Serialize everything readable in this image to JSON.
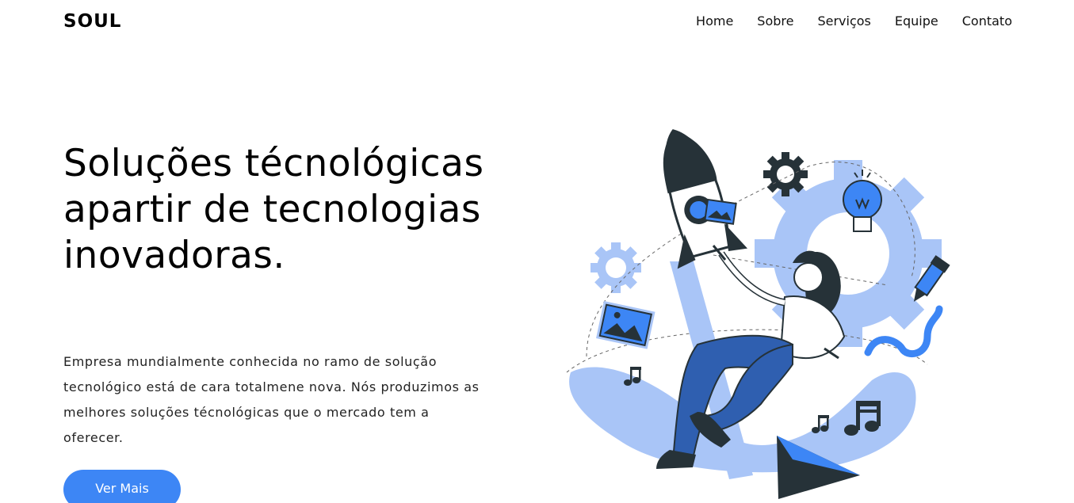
{
  "brand": {
    "name": "SOUL"
  },
  "nav": {
    "items": [
      {
        "label": "Home"
      },
      {
        "label": "Sobre"
      },
      {
        "label": "Serviços"
      },
      {
        "label": "Equipe"
      },
      {
        "label": "Contato"
      }
    ]
  },
  "hero": {
    "title": "Soluções técnológicas apartir de tecnologias inovadoras.",
    "description": "Empresa mundialmente conhecida no ramo de solução tecnológico está de cara totalmene nova. Nós produzimos as melhores soluções técnológicas que o mercado tem a oferecer.",
    "cta_label": "Ver Mais"
  },
  "colors": {
    "accent": "#3d86f5",
    "light_blue": "#a9c5f7",
    "dark": "#263238"
  },
  "illustration": {
    "icons": [
      "rocket-icon",
      "gear-icon",
      "lightbulb-icon",
      "image-icon",
      "music-note-icon",
      "paper-plane-icon",
      "marker-icon"
    ]
  }
}
